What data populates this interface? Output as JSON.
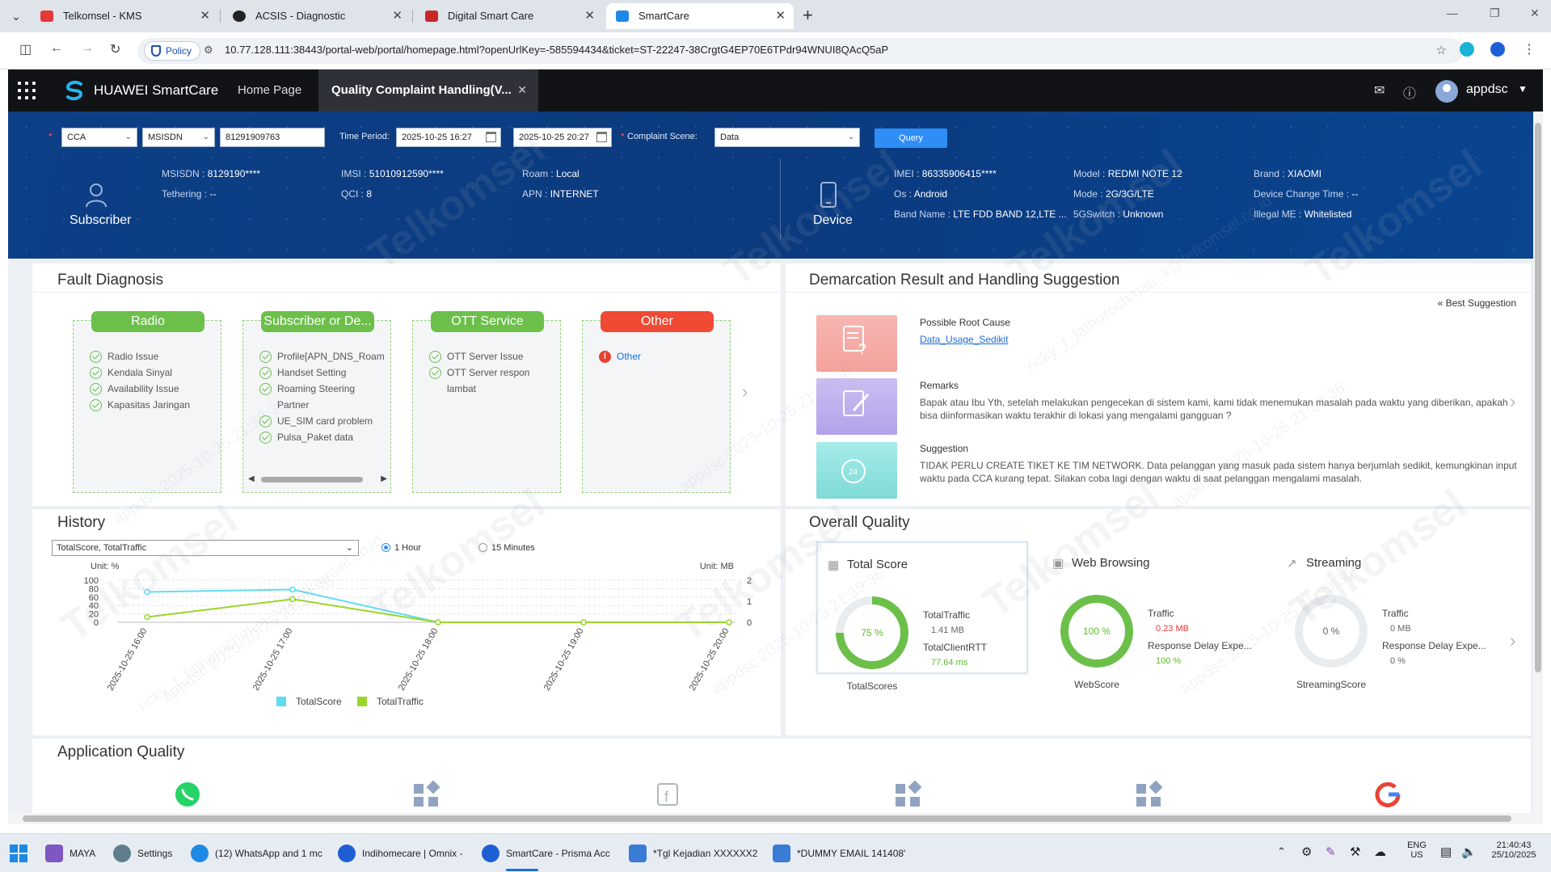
{
  "browser": {
    "tabs": [
      {
        "title": "Telkomsel - KMS",
        "color": "#e53935"
      },
      {
        "title": "ACSIS - Diagnostic",
        "color": "#222222"
      },
      {
        "title": "Digital Smart Care",
        "color": "#c62828"
      },
      {
        "title": "SmartCare",
        "color": "#1e88e5"
      }
    ],
    "active_tab_index": 3,
    "policy_label": "Policy",
    "url": "10.77.128.111:38443/portal-web/portal/homepage.html?openUrlKey=-585594434&ticket=ST-22247-38CrgtG4EP70E6TPdr94WNUI8QAcQ5aP"
  },
  "app": {
    "brand": "HUAWEI SmartCare",
    "nav_home": "Home Page",
    "nav_active": "Quality Complaint Handling(V...",
    "user": "appdsc"
  },
  "query": {
    "type_value": "CCA",
    "id_type_value": "MSISDN",
    "msisdn_value": "81291909763",
    "time_period_label": "Time Period:",
    "start_time": "2025-10-25 16:27",
    "end_time": "2025-10-25 20:27",
    "complaint_scene_label": "Complaint Scene:",
    "complaint_scene_value": "Data",
    "query_button": "Query"
  },
  "subscriber": {
    "label": "Subscriber",
    "fields": {
      "msisdn": {
        "k": "MSISDN :",
        "v": "8129190****"
      },
      "tethering": {
        "k": "Tethering :",
        "v": "--"
      },
      "imsi": {
        "k": "IMSI :",
        "v": "51010912590****"
      },
      "qci": {
        "k": "QCI :",
        "v": "8"
      },
      "roam": {
        "k": "Roam :",
        "v": "Local"
      },
      "apn": {
        "k": "APN :",
        "v": "INTERNET"
      }
    }
  },
  "device": {
    "label": "Device",
    "fields": {
      "imei": {
        "k": "IMEI :",
        "v": "86335906415****"
      },
      "os": {
        "k": "Os :",
        "v": "Android"
      },
      "band": {
        "k": "Band Name :",
        "v": "LTE FDD BAND 12,LTE ..."
      },
      "model": {
        "k": "Model :",
        "v": "REDMI NOTE 12"
      },
      "mode": {
        "k": "Mode :",
        "v": "2G/3G/LTE"
      },
      "switch5g": {
        "k": "5GSwitch :",
        "v": "Unknown"
      },
      "brand": {
        "k": "Brand :",
        "v": "XIAOMI"
      },
      "change_time": {
        "k": "Device Change Time :",
        "v": "--"
      },
      "illegal": {
        "k": "Illegal ME :",
        "v": "Whitelisted"
      }
    }
  },
  "fault": {
    "title": "Fault Diagnosis",
    "cards": [
      {
        "header": "Radio",
        "color": "#6cc04a",
        "items": [
          "Radio Issue",
          "Kendala Sinyal",
          "Availability Issue",
          "Kapasitas Jaringan"
        ]
      },
      {
        "header": "Subscriber or De...",
        "color": "#6cc04a",
        "items": [
          "Profile[APN_DNS_Roam",
          "Handset Setting",
          "Roaming Steering Partner",
          "UE_SIM card problem",
          "Pulsa_Paket data"
        ]
      },
      {
        "header": "OTT Service",
        "color": "#6cc04a",
        "items": [
          "OTT Server Issue",
          "OTT Server respon lambat"
        ]
      },
      {
        "header": "Other",
        "color": "#f04a35",
        "items": [
          "Other"
        ]
      }
    ]
  },
  "demarcation": {
    "title": "Demarcation Result and Handling Suggestion",
    "best_suggestion": "Best Suggestion",
    "root_cause_label": "Possible Root Cause",
    "root_cause_value": "Data_Usage_Sedikit",
    "remarks_label": "Remarks",
    "remarks_text": "Bapak atau Ibu Yth, setelah melakukan pengecekan di sistem kami, kami tidak menemukan masalah pada waktu yang diberikan, apakah bisa diinformasikan waktu terakhir di lokasi yang mengalami gangguan ?",
    "suggestion_label": "Suggestion",
    "suggestion_text": "TIDAK PERLU CREATE TIKET KE TIM NETWORK. Data pelanggan yang masuk pada sistem hanya berjumlah sedikit, kemungkinan input waktu pada CCA kurang tepat. Silakan coba lagi dengan waktu di saat pelanggan mengalami masalah."
  },
  "history": {
    "title": "History",
    "metric_select": "TotalScore, TotalTraffic",
    "radio_1h": "1 Hour",
    "radio_15m": "15 Minutes",
    "selected_interval": "1 Hour"
  },
  "chart_data": {
    "type": "line",
    "x": [
      "2025-10-25 16:00",
      "2025-10-25 17:00",
      "2025-10-25 18:00",
      "2025-10-25 19:00",
      "2025-10-25 20:00"
    ],
    "series": [
      {
        "name": "TotalScore",
        "axis": "left",
        "color": "#5fdcf2",
        "values": [
          72,
          78,
          0,
          0,
          0
        ]
      },
      {
        "name": "TotalTraffic",
        "axis": "right",
        "color": "#9ad62a",
        "values": [
          0.25,
          1.1,
          0,
          0,
          0
        ]
      }
    ],
    "ylabel_left": "Unit: %",
    "ylabel_right": "Unit: MB",
    "yticks_left": [
      "100",
      "80",
      "60",
      "40",
      "20",
      "0"
    ],
    "yticks_right": [
      "2",
      "1",
      "0"
    ],
    "ylim_left": [
      0,
      100
    ],
    "ylim_right": [
      0,
      2
    ],
    "legend_position": "bottom"
  },
  "overall": {
    "title": "Overall Quality",
    "cards": [
      {
        "title": "Total Score",
        "percent": "75 %",
        "fraction": 0.75,
        "ring_label": "TotalScores",
        "m1_label": "TotalTraffic",
        "m1_value": "1.41 MB",
        "m1_color": "#666666",
        "m2_label": "TotalClientRTT",
        "m2_value": "77.64 ms",
        "m2_color": "#5cbf2a"
      },
      {
        "title": "Web Browsing",
        "percent": "100 %",
        "fraction": 1.0,
        "ring_label": "WebScore",
        "m1_label": "Traffic",
        "m1_value": "0.23 MB",
        "m1_color": "#e53935",
        "m2_label": "Response Delay Expe...",
        "m2_value": "100 %",
        "m2_color": "#5cbf2a"
      },
      {
        "title": "Streaming",
        "percent": "0 %",
        "fraction": 0.0,
        "ring_label": "StreamingScore",
        "m1_label": "Traffic",
        "m1_value": "0 MB",
        "m1_color": "#666666",
        "m2_label": "Response Delay Expe...",
        "m2_value": "0 %",
        "m2_color": "#666666"
      }
    ]
  },
  "app_quality": {
    "title": "Application Quality",
    "icons": [
      "whatsapp-icon",
      "app-generic-icon",
      "facebook-icon",
      "app-generic-icon",
      "app-generic-icon",
      "google-icon"
    ]
  },
  "watermark": {
    "brand": "Telkomsel",
    "stamp": "appdsc 2025-10-25 21:39:36",
    "email": "ricky_f_fathurochman_x@telkomsel.co.id"
  },
  "taskbar": {
    "items": [
      {
        "label": "MAYA",
        "icon": "maya-icon",
        "color": "#7e57c2"
      },
      {
        "label": "Settings",
        "icon": "gear-icon",
        "color": "#607d8b"
      },
      {
        "label": "(12) WhatsApp and 1 mc",
        "icon": "edge-icon",
        "color": "#1e88e5"
      },
      {
        "label": "Indihomecare | Omnix -",
        "icon": "smartcare-icon",
        "color": "#1e5fd6"
      },
      {
        "label": "SmartCare - Prisma Acc",
        "icon": "smartcare-icon",
        "color": "#1e5fd6"
      },
      {
        "label": "*Tgl Kejadian   XXXXXX2",
        "icon": "notepad-icon",
        "color": "#3a7bd5"
      },
      {
        "label": "*DUMMY EMAIL 141408'",
        "icon": "notepad-icon",
        "color": "#3a7bd5"
      }
    ],
    "lang_1": "ENG",
    "lang_2": "US",
    "time": "21:40:43",
    "date": "25/10/2025"
  }
}
